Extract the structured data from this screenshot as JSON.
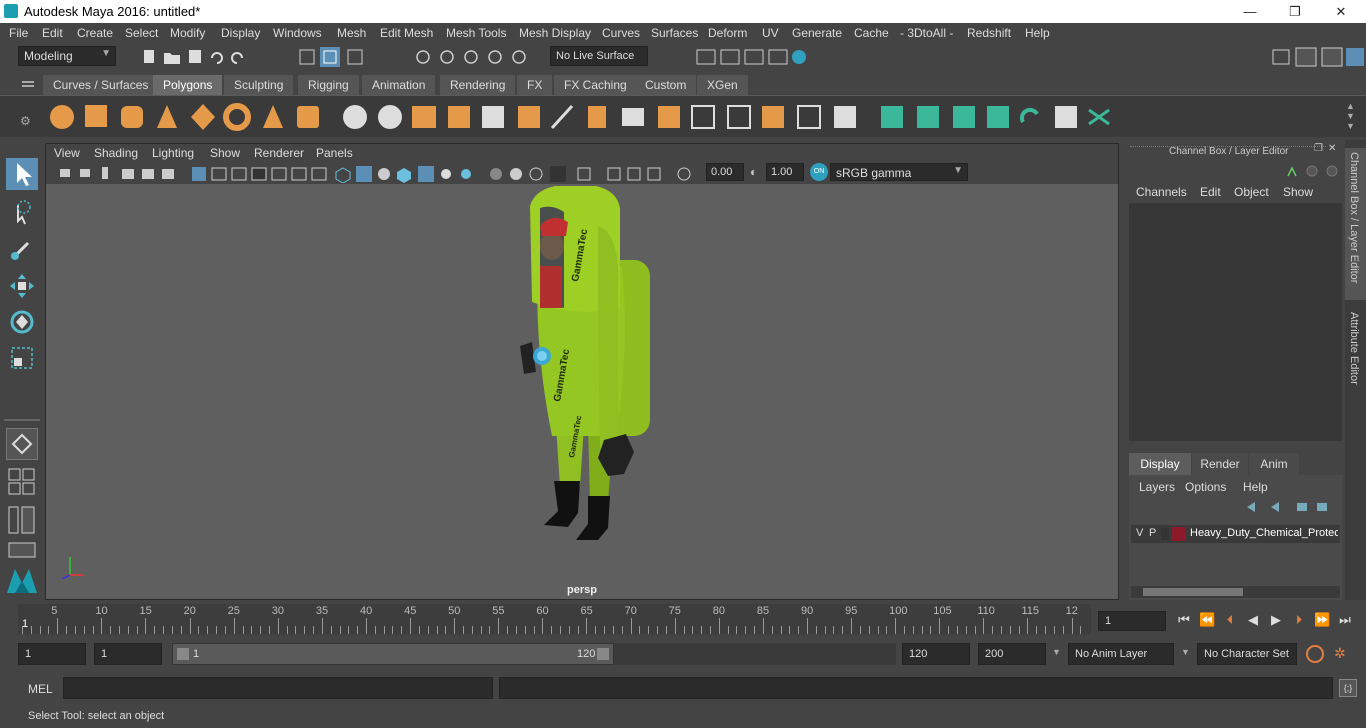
{
  "window": {
    "title": "Autodesk Maya 2016: untitled*",
    "minimize": "—",
    "maximize": "❐",
    "close": "✕"
  },
  "menubar": [
    "File",
    "Edit",
    "Create",
    "Select",
    "Modify",
    "Display",
    "Windows",
    "Mesh",
    "Edit Mesh",
    "Mesh Tools",
    "Mesh Display",
    "Curves",
    "Surfaces",
    "Deform",
    "UV",
    "Generate",
    "Cache",
    "- 3DtoAll -",
    "Redshift",
    "Help"
  ],
  "statusline": {
    "mode": "Modeling",
    "live_surface": "No Live Surface"
  },
  "shelf_tabs": [
    "Curves / Surfaces",
    "Polygons",
    "Sculpting",
    "Rigging",
    "Animation",
    "Rendering",
    "FX",
    "FX Caching",
    "Custom",
    "XGen"
  ],
  "shelf_active": "Polygons",
  "viewport": {
    "menu": [
      "View",
      "Shading",
      "Lighting",
      "Show",
      "Renderer",
      "Panels"
    ],
    "exposure": "0.00",
    "gamma": "1.00",
    "color_space": "sRGB gamma",
    "camera_label": "persp",
    "suit_text": "GammaTec"
  },
  "channel_box": {
    "header": "Channel Box / Layer Editor",
    "menu": [
      "Channels",
      "Edit",
      "Object",
      "Show"
    ]
  },
  "layer_editor": {
    "tabs": [
      "Display",
      "Render",
      "Anim"
    ],
    "active_tab": "Display",
    "menu": [
      "Layers",
      "Options",
      "Help"
    ],
    "layers": [
      {
        "v": "V",
        "p": "P",
        "color": "#8b1a2a",
        "name": "Heavy_Duty_Chemical_Protec"
      }
    ]
  },
  "side_tabs": [
    "Channel Box / Layer Editor",
    "Attribute Editor"
  ],
  "timeslider": {
    "ticks": [
      "5",
      "10",
      "15",
      "20",
      "25",
      "30",
      "35",
      "40",
      "45",
      "50",
      "55",
      "60",
      "65",
      "70",
      "75",
      "80",
      "85",
      "90",
      "95",
      "100",
      "105",
      "110",
      "115",
      "12"
    ],
    "current_marker": "1",
    "current_frame": "1"
  },
  "range": {
    "start": "1",
    "playback_start": "1",
    "slider_start": "1",
    "slider_end": "120",
    "playback_end": "120",
    "end": "200",
    "anim_layer": "No Anim Layer",
    "character_set": "No Character Set"
  },
  "cmdline": {
    "label": "MEL"
  },
  "helpline": "Select Tool: select an object"
}
